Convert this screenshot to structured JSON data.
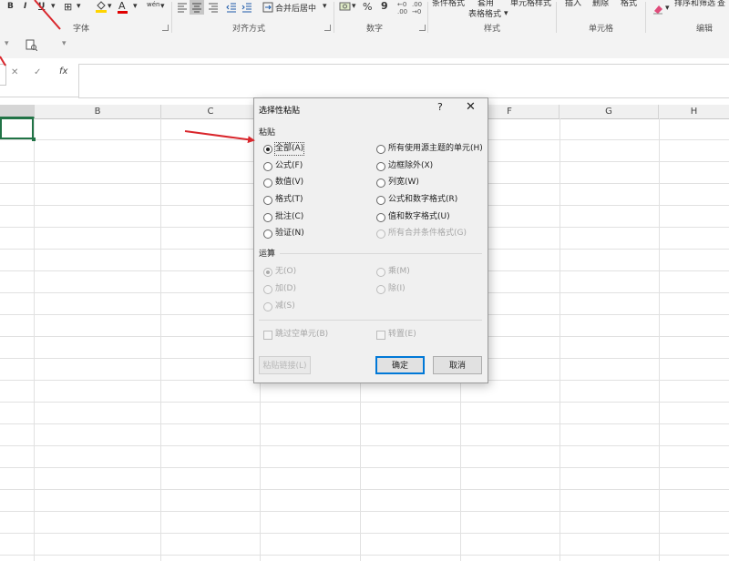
{
  "ribbon": {
    "bold": "B",
    "italic": "I",
    "underline": "U",
    "font_color_letter": "A",
    "wen": "wén",
    "font_group": "字体",
    "merge_center": "合并后居中",
    "align_group": "对齐方式",
    "percent": "%",
    "comma": "9",
    "number_group": "数字",
    "conditional_format": "条件格式",
    "table_format_top": "套用",
    "table_format_bottom": "表格格式",
    "cell_style": "单元格样式",
    "styles_group": "样式",
    "insert": "插入",
    "delete": "删除",
    "format": "格式",
    "cells_group": "单元格",
    "sort_filter": "排序和筛选",
    "find_select": "查",
    "edit_group": "编辑"
  },
  "formula_bar": {
    "cancel": "✕",
    "enter": "✓",
    "fx": "fx"
  },
  "columns": [
    "B",
    "C",
    "F",
    "G",
    "H"
  ],
  "dialog": {
    "title": "选择性粘贴",
    "help": "?",
    "close": "✕",
    "paste_section": "粘贴",
    "paste_options_left": [
      "全部(A)",
      "公式(F)",
      "数值(V)",
      "格式(T)",
      "批注(C)",
      "验证(N)"
    ],
    "paste_options_right": [
      "所有使用源主题的单元(H)",
      "边框除外(X)",
      "列宽(W)",
      "公式和数字格式(R)",
      "值和数字格式(U)",
      "所有合并条件格式(G)"
    ],
    "selected_option": "全部(A)",
    "operation_section": "运算",
    "operation_left": [
      "无(O)",
      "加(D)",
      "减(S)"
    ],
    "operation_right": [
      "乘(M)",
      "除(I)"
    ],
    "skip_blanks": "跳过空单元(B)",
    "transpose": "转置(E)",
    "paste_link": "粘贴链接(L)",
    "ok": "确定",
    "cancel": "取消"
  },
  "colors": {
    "accent_green": "#217346",
    "arrow_red": "#d9262c",
    "default_button_border": "#0078d7"
  }
}
